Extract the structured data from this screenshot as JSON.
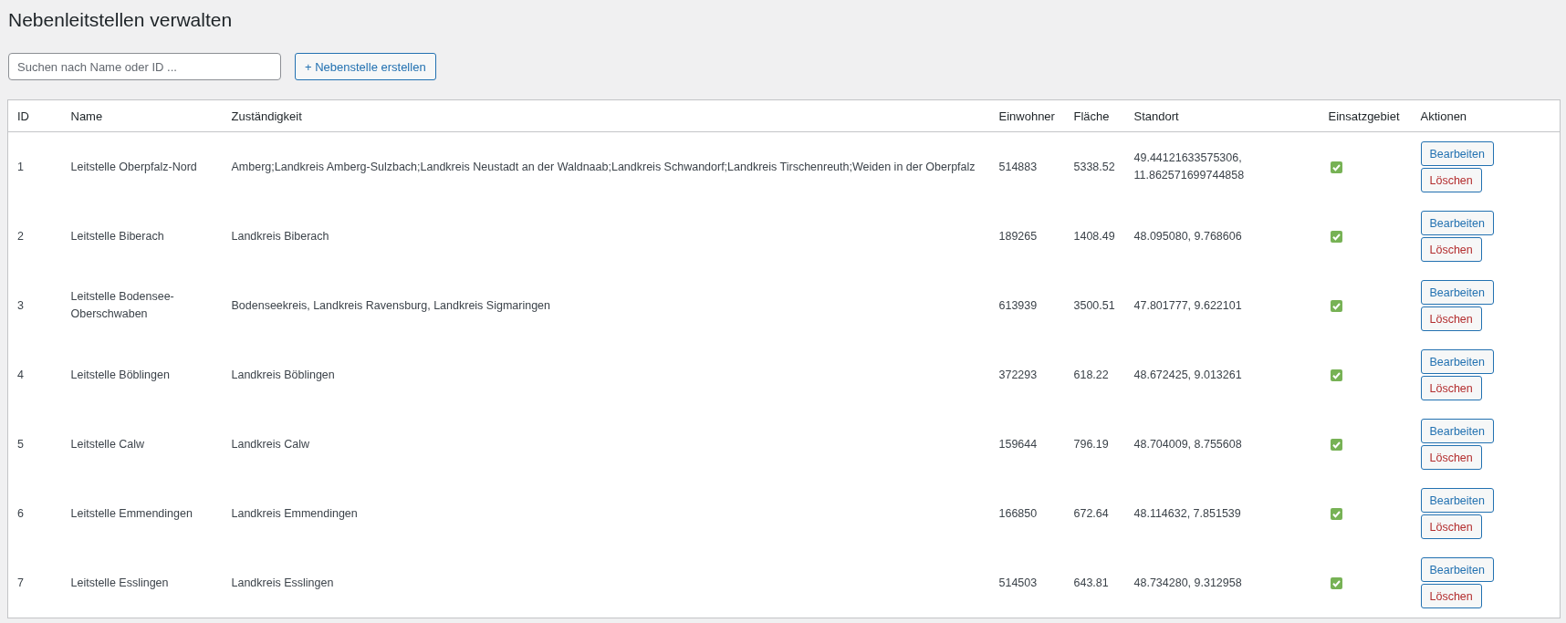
{
  "page_title": "Nebenleitstellen verwalten",
  "search": {
    "placeholder": "Suchen nach Name oder ID ..."
  },
  "create_button": "+ Nebenstelle erstellen",
  "table": {
    "columns": [
      "ID",
      "Name",
      "Zuständigkeit",
      "Einwohner",
      "Fläche",
      "Standort",
      "Einsatzgebiet",
      "Aktionen"
    ],
    "rows": [
      {
        "id": "1",
        "name": "Leitstelle Oberpfalz-Nord",
        "zustaendigkeit": "Amberg;Landkreis Amberg-Sulzbach;Landkreis Neustadt an der Waldnaab;Landkreis Schwandorf;Landkreis Tirschenreuth;Weiden in der Oberpfalz",
        "einwohner": "514883",
        "flaeche": "5338.52",
        "standort": "49.44121633575306, 11.862571699744858",
        "einsatzgebiet": true,
        "actions": [
          "Bearbeiten",
          "Löschen"
        ]
      },
      {
        "id": "2",
        "name": "Leitstelle Biberach",
        "zustaendigkeit": "Landkreis Biberach",
        "einwohner": "189265",
        "flaeche": "1408.49",
        "standort": "48.095080, 9.768606",
        "einsatzgebiet": true,
        "actions": [
          "Bearbeiten",
          "Löschen"
        ]
      },
      {
        "id": "3",
        "name": "Leitstelle Bodensee-Oberschwaben",
        "zustaendigkeit": "Bodenseekreis, Landkreis Ravensburg, Landkreis Sigmaringen",
        "einwohner": "613939",
        "flaeche": "3500.51",
        "standort": "47.801777, 9.622101",
        "einsatzgebiet": true,
        "actions": [
          "Bearbeiten",
          "Löschen"
        ]
      },
      {
        "id": "4",
        "name": "Leitstelle Böblingen",
        "zustaendigkeit": "Landkreis Böblingen",
        "einwohner": "372293",
        "flaeche": "618.22",
        "standort": "48.672425, 9.013261",
        "einsatzgebiet": true,
        "actions": [
          "Bearbeiten",
          "Löschen"
        ]
      },
      {
        "id": "5",
        "name": "Leitstelle Calw",
        "zustaendigkeit": "Landkreis Calw",
        "einwohner": "159644",
        "flaeche": "796.19",
        "standort": "48.704009, 8.755608",
        "einsatzgebiet": true,
        "actions": [
          "Bearbeiten",
          "Löschen"
        ]
      },
      {
        "id": "6",
        "name": "Leitstelle Emmendingen",
        "zustaendigkeit": "Landkreis Emmendingen",
        "einwohner": "166850",
        "flaeche": "672.64",
        "standort": "48.114632, 7.851539",
        "einsatzgebiet": true,
        "actions": [
          "Bearbeiten",
          "Löschen"
        ]
      },
      {
        "id": "7",
        "name": "Leitstelle Esslingen",
        "zustaendigkeit": "Landkreis Esslingen",
        "einwohner": "514503",
        "flaeche": "643.81",
        "standort": "48.734280, 9.312958",
        "einsatzgebiet": true,
        "actions": [
          "Bearbeiten",
          "Löschen"
        ]
      }
    ]
  }
}
